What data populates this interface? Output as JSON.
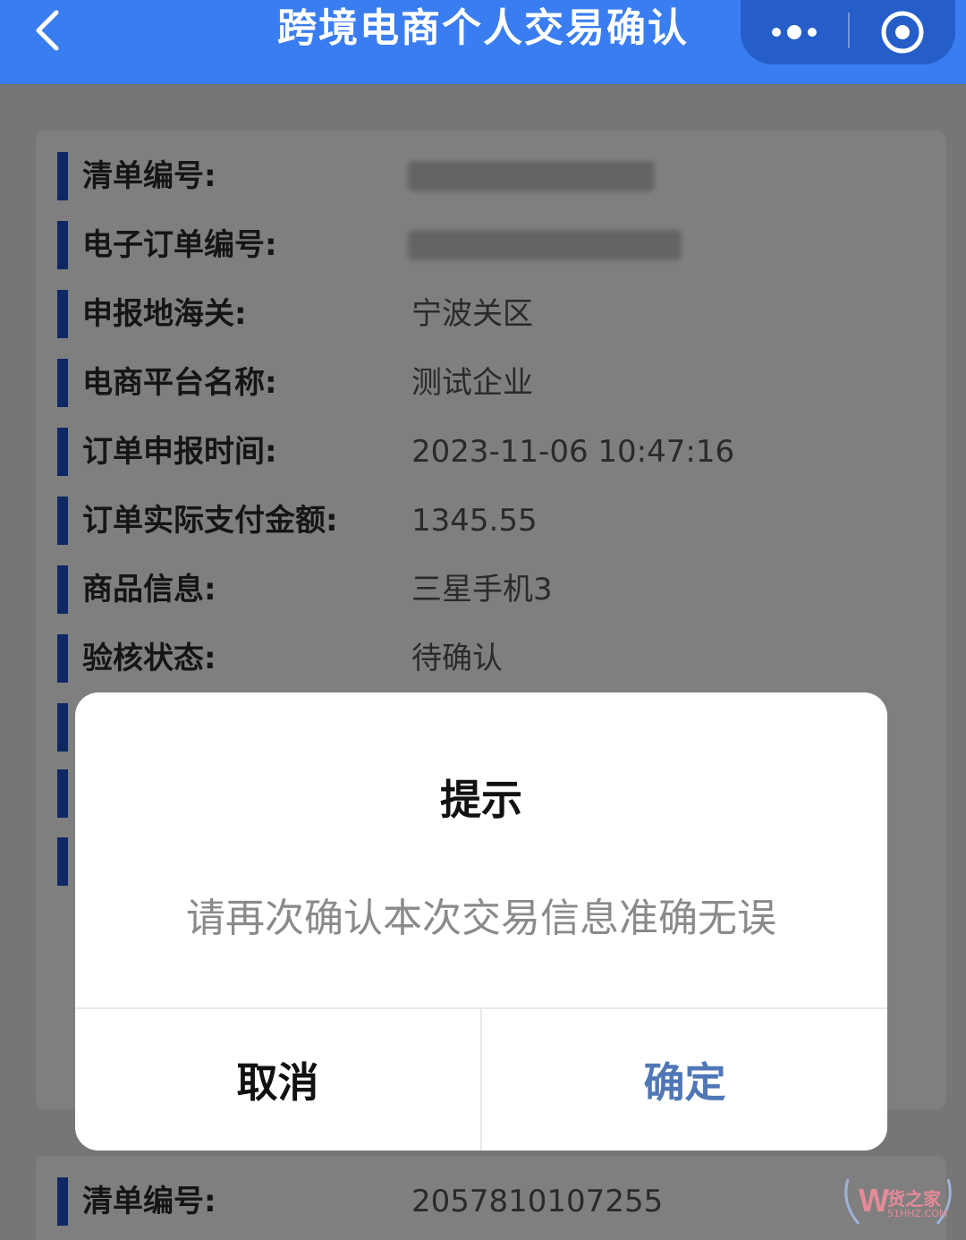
{
  "header": {
    "title": "跨境电商个人交易确认"
  },
  "icons": {
    "back": "chevron-left-icon",
    "more": "more-dots-icon",
    "close": "target-circle-icon"
  },
  "colors": {
    "header_bg": "#3a7df0",
    "accent_bar": "#1f4fc9",
    "confirm_text": "#5077b5"
  },
  "order": {
    "rows": [
      {
        "label": "清单编号:",
        "value": ""
      },
      {
        "label": "电子订单编号:",
        "value": ""
      },
      {
        "label": "申报地海关:",
        "value": "宁波关区"
      },
      {
        "label": "电商平台名称:",
        "value": "测试企业"
      },
      {
        "label": "订单申报时间:",
        "value": "2023-11-06 10:47:16"
      },
      {
        "label": "订单实际支付金额:",
        "value": "1345.55"
      },
      {
        "label": "商品信息:",
        "value": "三星手机3"
      },
      {
        "label": "验核状态:",
        "value": "待确认"
      }
    ]
  },
  "second_order": {
    "rows": [
      {
        "label": "清单编号:",
        "value": "2057810107255"
      }
    ]
  },
  "dialog": {
    "title": "提示",
    "message": "请再次确认本次交易信息准确无误",
    "cancel_label": "取消",
    "confirm_label": "确定"
  },
  "watermark": {
    "name": "货之家",
    "domain": "51HHZ.COM"
  }
}
